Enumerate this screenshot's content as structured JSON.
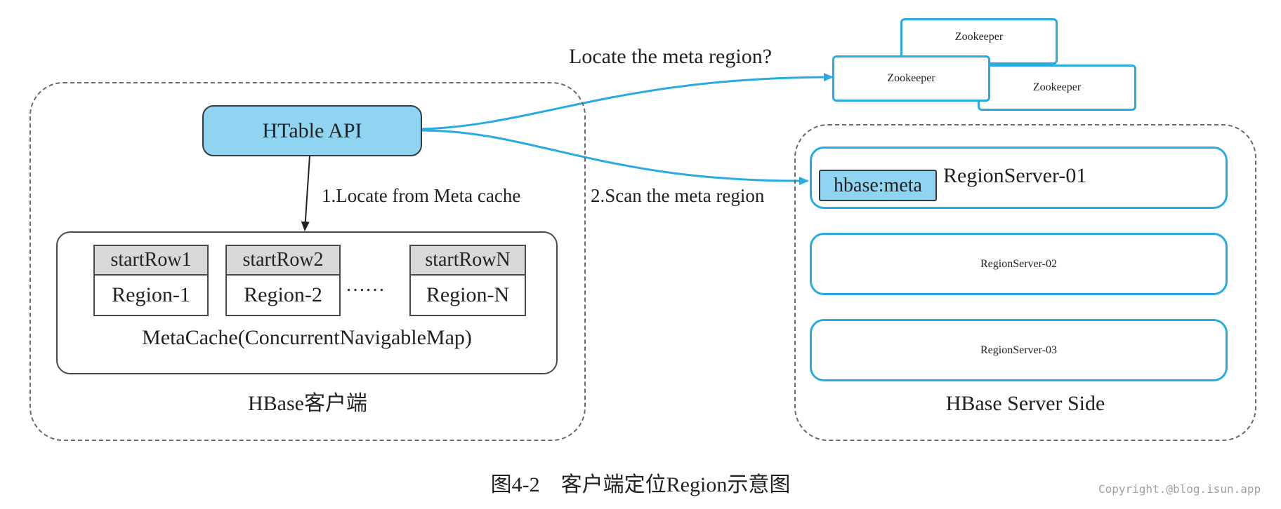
{
  "client": {
    "htable": "HTable API",
    "step1": "1.Locate from Meta cache",
    "cache_label": "MetaCache(ConcurrentNavigableMap)",
    "panel_label": "HBase客户端",
    "ellipsis": "……",
    "regions": [
      {
        "start": "startRow1",
        "region": "Region-1"
      },
      {
        "start": "startRow2",
        "region": "Region-2"
      },
      {
        "start": "startRowN",
        "region": "Region-N"
      }
    ]
  },
  "zookeeper": {
    "question": "Locate the meta region?",
    "nodes": [
      "Zookeeper",
      "Zookeeper",
      "Zookeeper"
    ]
  },
  "server": {
    "step2": "2.Scan the meta region",
    "meta": "hbase:meta",
    "servers": [
      "RegionServer-01",
      "RegionServer-02",
      "RegionServer-03"
    ],
    "panel_label": "HBase Server Side"
  },
  "caption": "图4-2　客户端定位Region示意图",
  "copyright": "Copyright.@blog.isun.app",
  "colors": {
    "accent": "#29abe2",
    "fill": "#8fd5f2"
  }
}
